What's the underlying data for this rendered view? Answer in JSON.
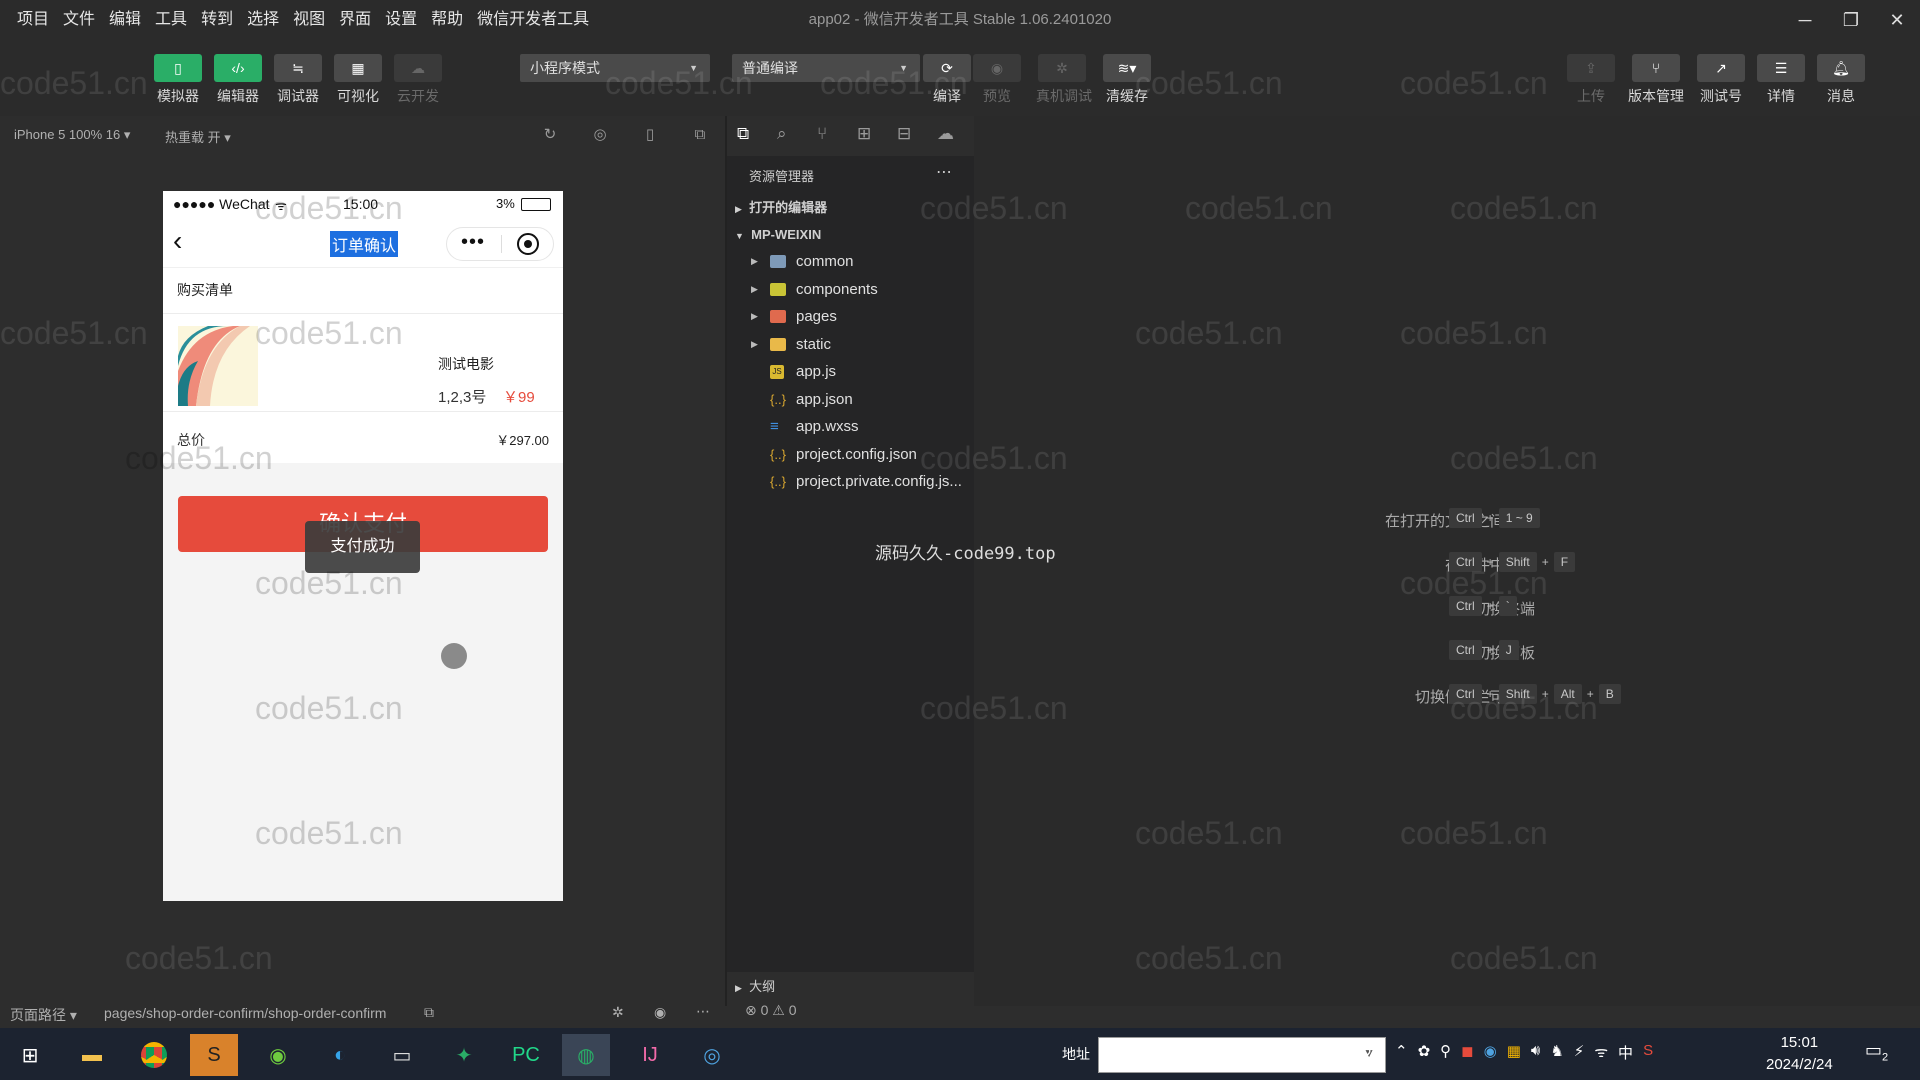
{
  "menu": [
    "项目",
    "文件",
    "编辑",
    "工具",
    "转到",
    "选择",
    "视图",
    "界面",
    "设置",
    "帮助",
    "微信开发者工具"
  ],
  "window_title": "app02 - 微信开发者工具 Stable 1.06.2401020",
  "toolbar": {
    "left_buttons": [
      {
        "label": "模拟器",
        "icon": "phone-icon"
      },
      {
        "label": "编辑器",
        "icon": "code-icon"
      },
      {
        "label": "调试器",
        "icon": "debugger-icon"
      },
      {
        "label": "可视化",
        "icon": "layout-icon"
      },
      {
        "label": "云开发",
        "icon": "cloud-icon"
      }
    ],
    "mode_select": "小程序模式",
    "compile_select": "普通编译",
    "mid_buttons": [
      {
        "label": "编译",
        "icon": "refresh-icon"
      },
      {
        "label": "预览",
        "icon": "eye-icon"
      },
      {
        "label": "真机调试",
        "icon": "bug-icon"
      },
      {
        "label": "清缓存",
        "icon": "layers-icon"
      }
    ],
    "right_buttons": [
      {
        "label": "上传",
        "icon": "upload-icon"
      },
      {
        "label": "版本管理",
        "icon": "branch-icon"
      },
      {
        "label": "测试号",
        "icon": "external-link-icon"
      },
      {
        "label": "详情",
        "icon": "menu-icon"
      },
      {
        "label": "消息",
        "icon": "bell-icon"
      }
    ]
  },
  "simulator_bar": {
    "device": "iPhone 5 100% 16 ▾",
    "hot_reload": "热重载 开 ▾"
  },
  "phone": {
    "status": {
      "carrier": "●●●●● WeChat",
      "time": "15:00",
      "battery": "3%"
    },
    "nav_title": "订单确认",
    "section_title": "购买清单",
    "item": {
      "name": "测试电影",
      "seats": "1,2,3号",
      "price": "￥99"
    },
    "total_label": "总价",
    "total_value": "￥297.00",
    "pay_button": "确认支付",
    "toast": "支付成功"
  },
  "explorer": {
    "title": "资源管理器",
    "open_editors": "打开的编辑器",
    "project": "MP-WEIXIN",
    "items": [
      {
        "name": "common",
        "type": "folder",
        "color": "#7e9ab8"
      },
      {
        "name": "components",
        "type": "folder",
        "color": "#c9c436"
      },
      {
        "name": "pages",
        "type": "folder",
        "color": "#e06a4e"
      },
      {
        "name": "static",
        "type": "folder",
        "color": "#e9b949"
      },
      {
        "name": "app.js",
        "type": "js",
        "color": "#d9b930"
      },
      {
        "name": "app.json",
        "type": "json",
        "color": "#d9a730"
      },
      {
        "name": "app.wxss",
        "type": "css",
        "color": "#3f8fe0"
      },
      {
        "name": "project.config.json",
        "type": "json",
        "color": "#d9a730"
      },
      {
        "name": "project.private.config.js...",
        "type": "json",
        "color": "#d9a730"
      }
    ],
    "outline": "大纲",
    "problems": "⊗ 0 ⚠ 0"
  },
  "overlay_text": "源码久久-code99.top",
  "shortcuts": [
    {
      "label": "在打开的文件之间切换",
      "keys": [
        "Ctrl",
        "+",
        "1 ~ 9"
      ]
    },
    {
      "label": "在文件中查找",
      "keys": [
        "Ctrl",
        "+",
        "Shift",
        "+",
        "F"
      ]
    },
    {
      "label": "切换终端",
      "keys": [
        "Ctrl",
        "+",
        "`"
      ]
    },
    {
      "label": "切换面板",
      "keys": [
        "Ctrl",
        "+",
        "J"
      ]
    },
    {
      "label": "切换侧边栏可见性",
      "keys": [
        "Ctrl",
        "+",
        "Shift",
        "+",
        "Alt",
        "+",
        "B"
      ]
    }
  ],
  "statusbar": {
    "page_path_label": "页面路径 ▾",
    "page_path": "pages/shop-order-confirm/shop-order-confirm"
  },
  "taskbar": {
    "address_label": "地址",
    "time": "15:01",
    "date": "2024/2/24",
    "ime": "中",
    "notifications": "2"
  },
  "watermark": "code51.cn"
}
